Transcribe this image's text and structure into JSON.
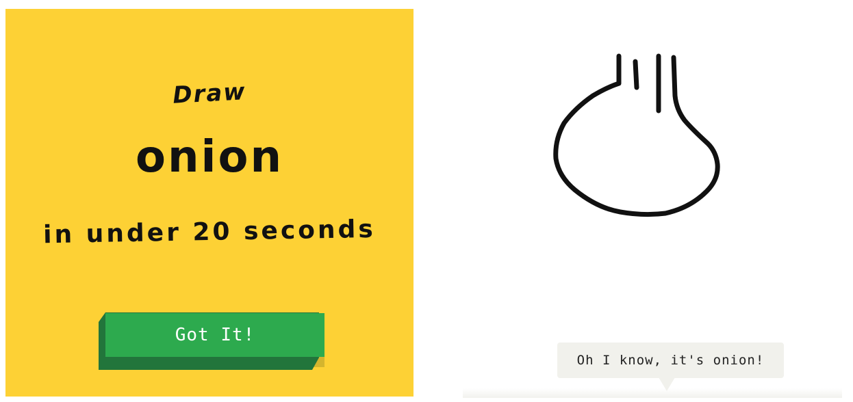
{
  "prompt": {
    "draw_label": "Draw",
    "word": "onion",
    "time_limit": "in under 20 seconds",
    "button_label": "Got It!"
  },
  "guess": {
    "text": "Oh I know, it's onion!"
  },
  "colors": {
    "card_background": "#fdd135",
    "button_green": "#2daa4e",
    "button_dark_green": "#22753b",
    "bubble_background": "#f1f1ec",
    "ink": "#111111"
  }
}
